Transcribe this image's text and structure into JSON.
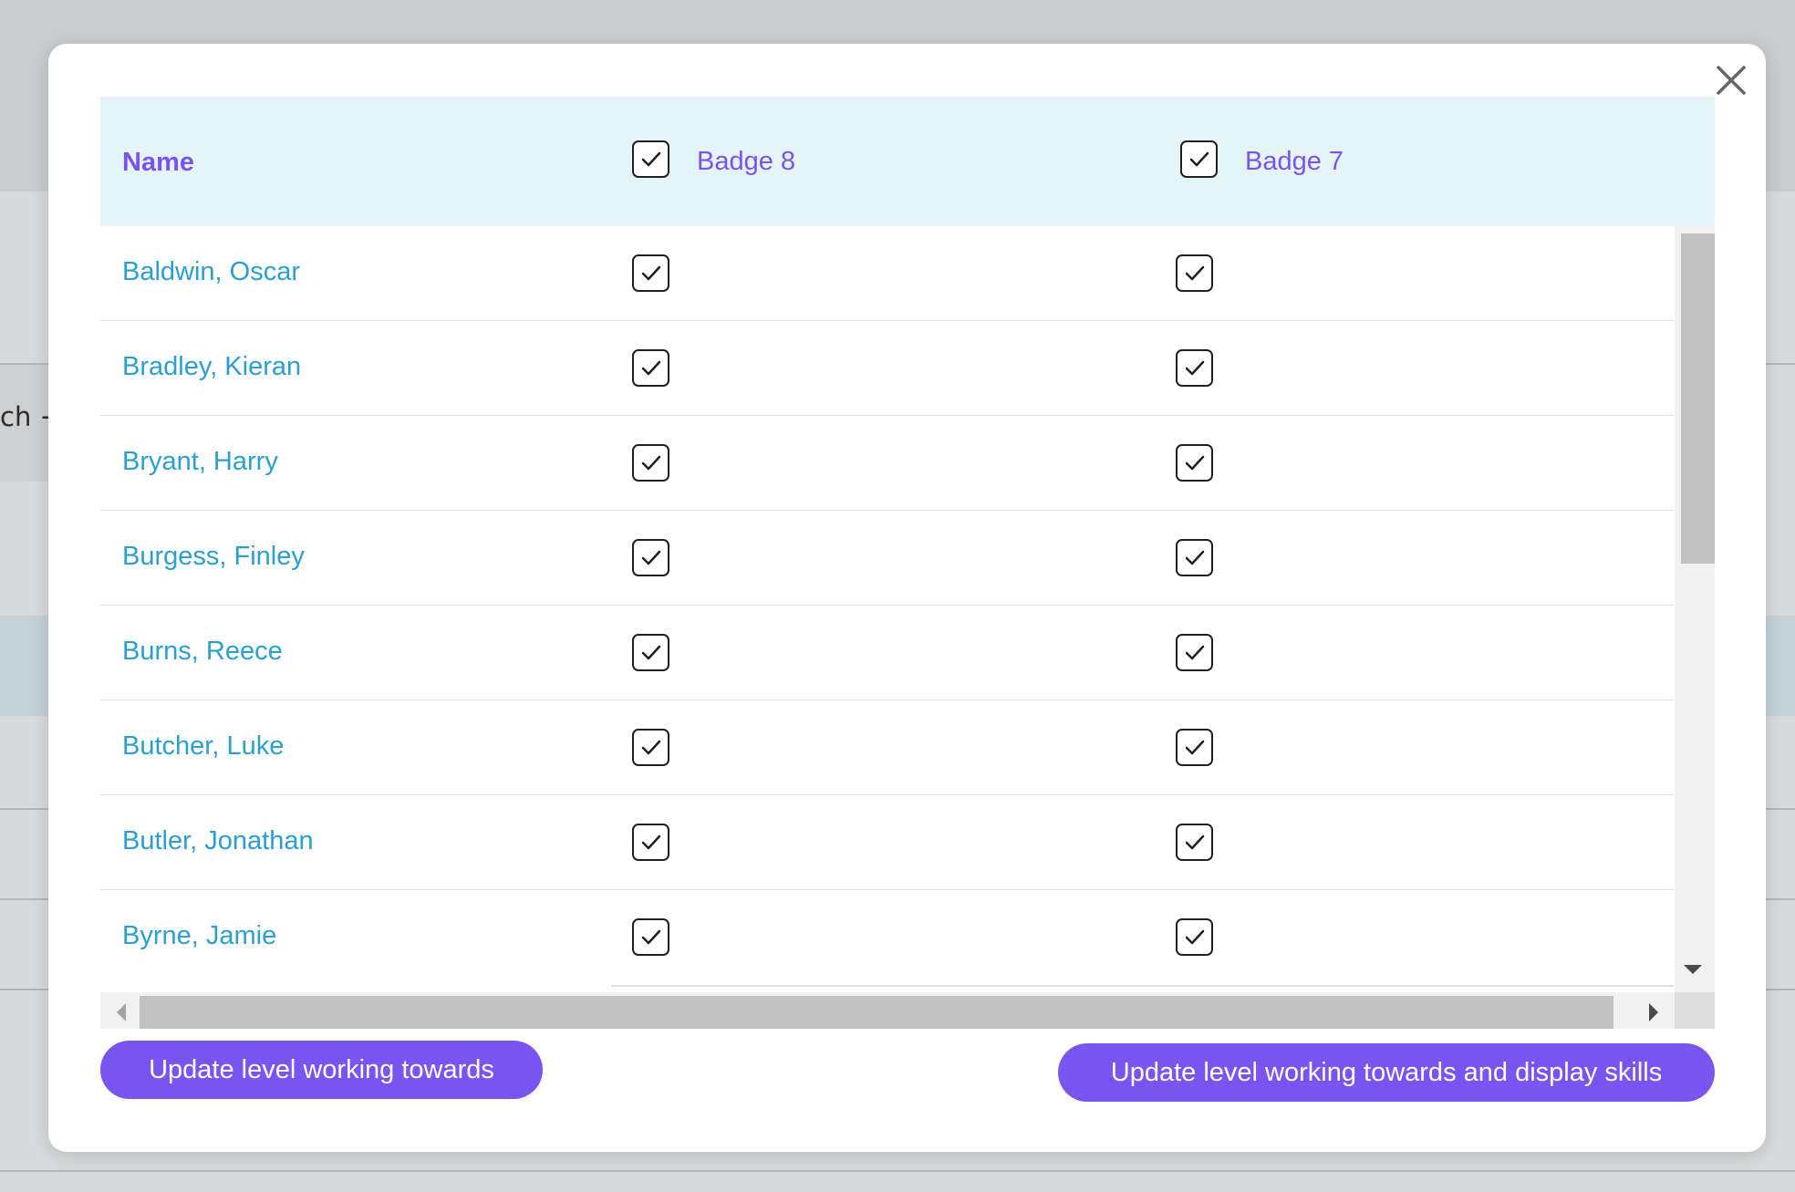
{
  "background": {
    "fragment_text": "ch +"
  },
  "modal": {
    "close_icon": "close-icon",
    "table": {
      "header_name": "Name",
      "columns": [
        {
          "label": "Badge 8",
          "checked": true
        },
        {
          "label": "Badge 7",
          "checked": true
        }
      ],
      "rows": [
        {
          "name": "Baldwin, Oscar",
          "badge8": true,
          "badge7": true
        },
        {
          "name": "Bradley, Kieran",
          "badge8": true,
          "badge7": true
        },
        {
          "name": "Bryant, Harry",
          "badge8": true,
          "badge7": true
        },
        {
          "name": "Burgess, Finley",
          "badge8": true,
          "badge7": true
        },
        {
          "name": "Burns, Reece",
          "badge8": true,
          "badge7": true
        },
        {
          "name": "Butcher, Luke",
          "badge8": true,
          "badge7": true
        },
        {
          "name": "Butler, Jonathan",
          "badge8": true,
          "badge7": true
        },
        {
          "name": "Byrne, Jamie",
          "badge8": true,
          "badge7": true
        }
      ]
    },
    "buttons": {
      "update_label": "Update level working towards",
      "update_display_label": "Update level working towards and display skills"
    }
  },
  "colors": {
    "accent": "#7a54f0",
    "link": "#2a9fd0",
    "header_bg": "#e5f4f9"
  }
}
